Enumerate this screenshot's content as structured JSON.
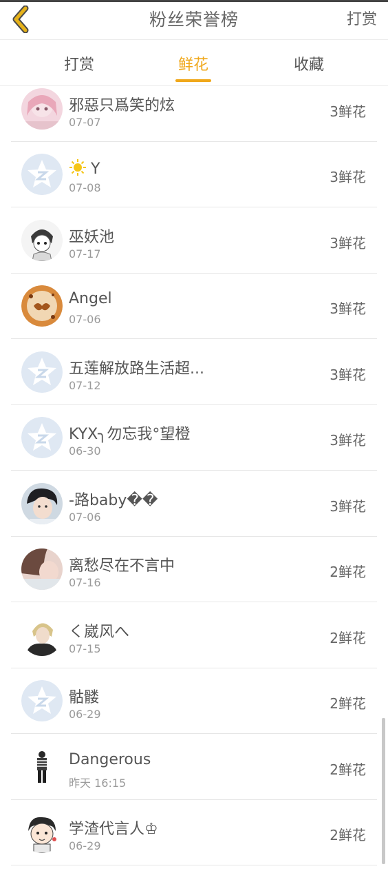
{
  "header": {
    "title": "粉丝荣誉榜",
    "right_action": "打赏",
    "back_icon": "chevron-left-icon",
    "back_color": "#e6b21a"
  },
  "tabs": [
    {
      "label": "打赏",
      "active": false
    },
    {
      "label": "鲜花",
      "active": true
    },
    {
      "label": "收藏",
      "active": false
    }
  ],
  "accent_color": "#f0a81b",
  "rows": [
    {
      "name": "邪惡只爲笑的炫",
      "date": "07-07",
      "count": "3鲜花",
      "avatar": "pink-anime-avatar"
    },
    {
      "name": "Y",
      "date": "07-08",
      "count": "3鲜花",
      "avatar": "default-qq-avatar",
      "prefix_icon": "sun-icon"
    },
    {
      "name": "巫妖池",
      "date": "07-17",
      "count": "3鲜花",
      "avatar": "sketch-boy-avatar"
    },
    {
      "name": "Angel",
      "date": "07-06",
      "count": "3鲜花",
      "avatar": "cookie-avatar"
    },
    {
      "name": "五莲解放路生活超...",
      "date": "07-12",
      "count": "3鲜花",
      "avatar": "default-qq-avatar"
    },
    {
      "name": "KYX╮勿忘我°望橙",
      "date": "06-30",
      "count": "3鲜花",
      "avatar": "default-qq-avatar"
    },
    {
      "name": "-路baby��",
      "date": "07-06",
      "count": "3鲜花",
      "avatar": "boy-photo-avatar"
    },
    {
      "name": "离愁尽在不言中",
      "date": "07-16",
      "count": "2鲜花",
      "avatar": "girl-photo-avatar"
    },
    {
      "name": "く崴风へ",
      "date": "07-15",
      "count": "2鲜花",
      "avatar": "blonde-photo-avatar"
    },
    {
      "name": "骷髅",
      "date": "06-29",
      "count": "2鲜花",
      "avatar": "default-qq-avatar"
    },
    {
      "name": "Dangerous",
      "date": "昨天 16:15",
      "count": "2鲜花",
      "avatar": "figure-avatar"
    },
    {
      "name": "学渣代言人♔",
      "date": "06-29",
      "count": "2鲜花",
      "avatar": "cartoon-boy-avatar"
    }
  ]
}
